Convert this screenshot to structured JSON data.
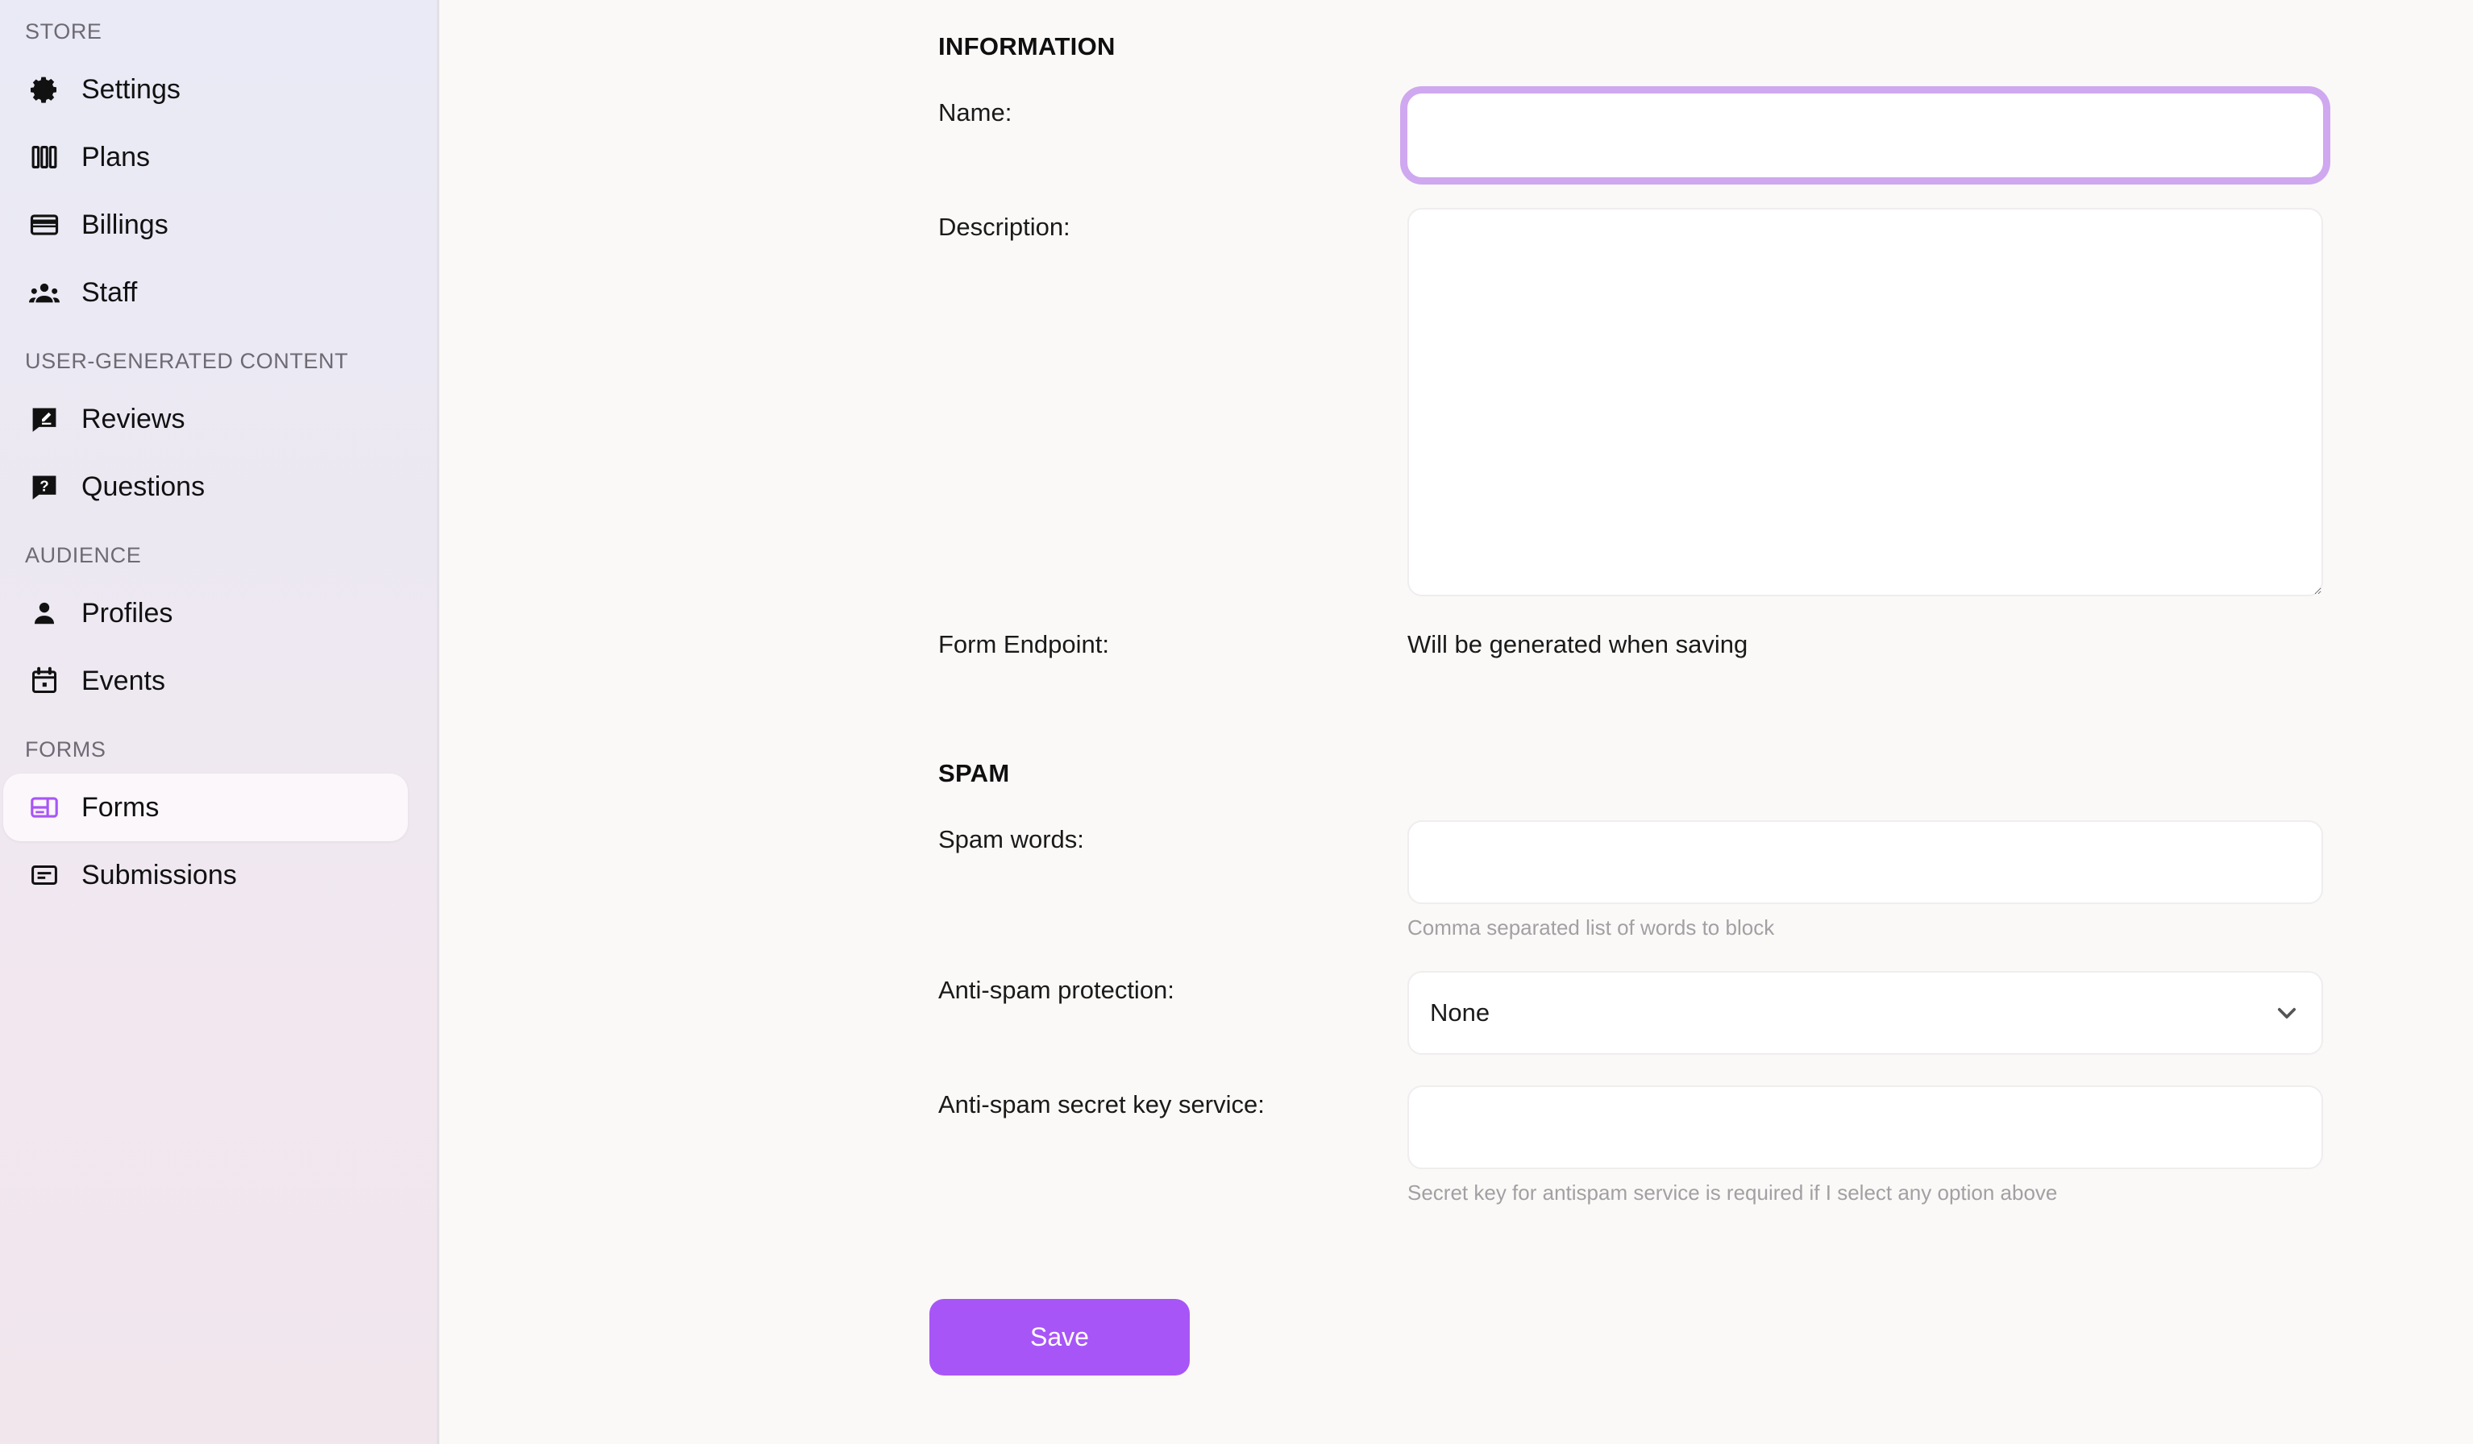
{
  "sidebar": {
    "sections": [
      {
        "title": "STORE",
        "items": [
          {
            "label": "Settings",
            "icon": "gear-icon",
            "active": false
          },
          {
            "label": "Plans",
            "icon": "bars-icon",
            "active": false
          },
          {
            "label": "Billings",
            "icon": "credit-card-icon",
            "active": false
          },
          {
            "label": "Staff",
            "icon": "people-icon",
            "active": false
          }
        ]
      },
      {
        "title": "USER-GENERATED CONTENT",
        "items": [
          {
            "label": "Reviews",
            "icon": "review-bubble-icon",
            "active": false
          },
          {
            "label": "Questions",
            "icon": "question-bubble-icon",
            "active": false
          }
        ]
      },
      {
        "title": "AUDIENCE",
        "items": [
          {
            "label": "Profiles",
            "icon": "person-icon",
            "active": false
          },
          {
            "label": "Events",
            "icon": "calendar-icon",
            "active": false
          }
        ]
      },
      {
        "title": "FORMS",
        "items": [
          {
            "label": "Forms",
            "icon": "form-layout-icon",
            "active": true
          },
          {
            "label": "Submissions",
            "icon": "submission-card-icon",
            "active": false
          }
        ]
      }
    ]
  },
  "main": {
    "information": {
      "heading": "INFORMATION",
      "name": {
        "label": "Name:",
        "value": "",
        "placeholder": ""
      },
      "description": {
        "label": "Description:",
        "value": "",
        "placeholder": ""
      },
      "form_endpoint": {
        "label": "Form Endpoint:",
        "value": "Will be generated when saving"
      }
    },
    "spam": {
      "heading": "SPAM",
      "spam_words": {
        "label": "Spam words:",
        "value": "",
        "placeholder": "",
        "hint": "Comma separated list of words to block"
      },
      "anti_spam_protection": {
        "label": "Anti-spam protection:",
        "value": "None",
        "options": [
          "None"
        ]
      },
      "anti_spam_secret_key": {
        "label": "Anti-spam secret key service:",
        "value": "",
        "placeholder": "",
        "hint": "Secret key for antispam service is required if I select any option above"
      }
    },
    "save_label": "Save"
  },
  "colors": {
    "accent": "#A855F7",
    "focus_ring": "#CFA8F0",
    "page_background": "#FAF9F7",
    "hint_text": "#A2A0A3"
  }
}
